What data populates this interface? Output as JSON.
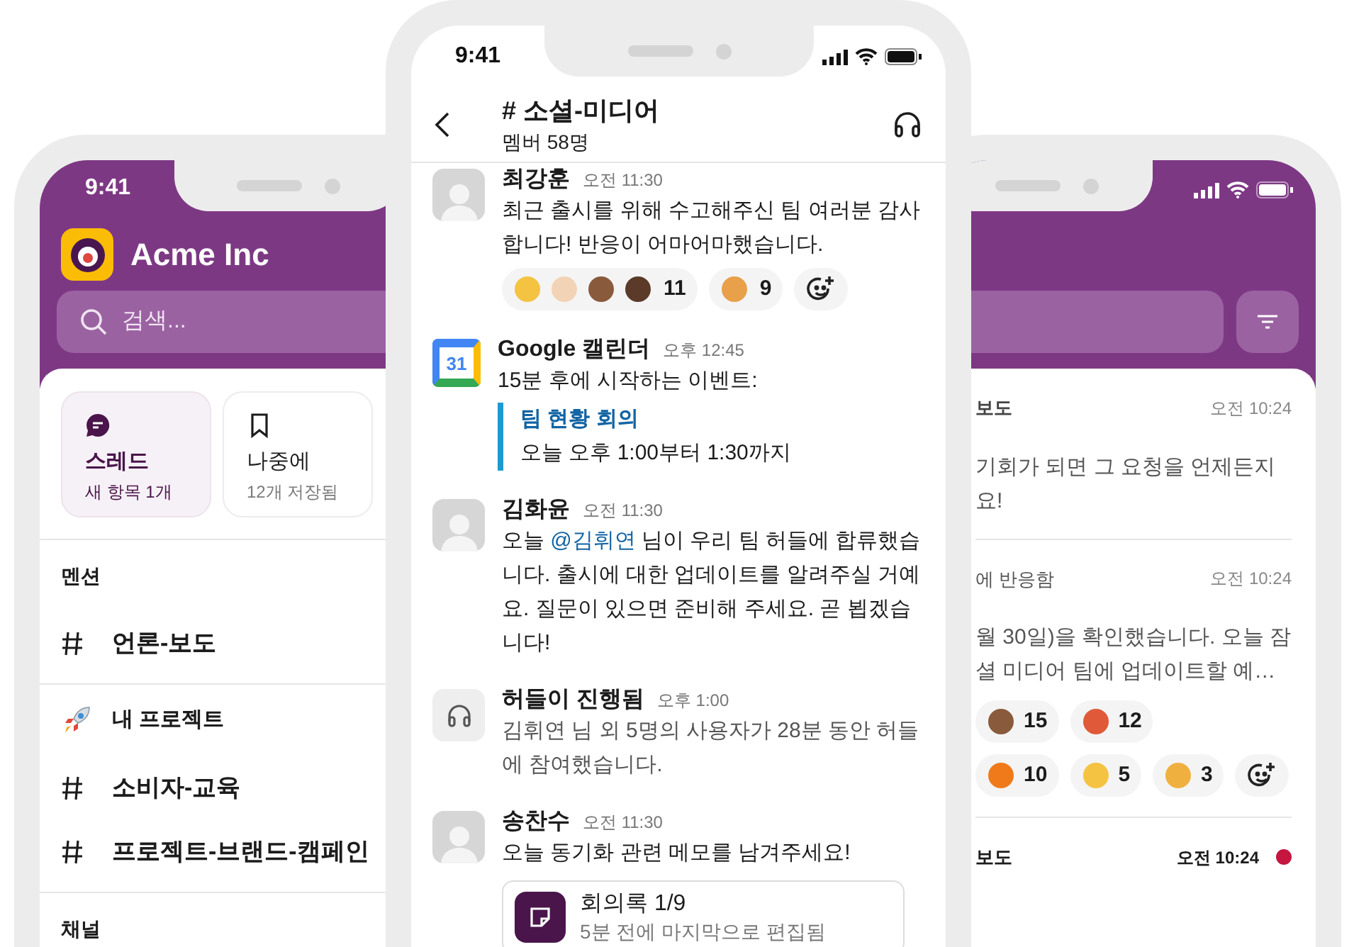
{
  "left_phone": {
    "status_time": "9:41",
    "workspace": "Acme Inc",
    "search": {
      "placeholder": "검색..."
    },
    "shortcuts": [
      {
        "kind": "thread",
        "label": "스레드",
        "sublabel": "새 항목 1개",
        "selected": true
      },
      {
        "kind": "bookmark",
        "label": "나중에",
        "sublabel": "12개 저장됨",
        "selected": false
      }
    ],
    "sections": [
      {
        "kind": "plain",
        "title": "멘션",
        "channels": [
          "언론-보도"
        ]
      },
      {
        "kind": "rocket",
        "title": "내 프로젝트",
        "channels": [
          "소비자-교육",
          "프로젝트-브랜드-캠페인"
        ]
      },
      {
        "kind": "plain",
        "title": "채널"
      }
    ]
  },
  "center_phone": {
    "status_time": "9:41",
    "channel_title": "# 소셜-미디어",
    "member_count": "멤버 58명",
    "messages": [
      {
        "kind": "user",
        "author": "최강훈",
        "time": "오전 11:30",
        "text_parts": [
          {
            "kind": "plain",
            "text": "최근 출시를 위해 수고해주신 팀 여러분 감사합니다! 반응이 어마어마했습니다."
          }
        ],
        "reactions": [
          {
            "emojis": [
              {
                "kind": "clap_default"
              },
              {
                "kind": "clap_light"
              },
              {
                "kind": "clap_medium_dark"
              },
              {
                "kind": "clap_dark"
              }
            ],
            "count": "11"
          },
          {
            "emojis": [
              {
                "kind": "party"
              }
            ],
            "count": "9"
          }
        ]
      },
      {
        "kind": "calendar",
        "author": "Google 캘린더",
        "time": "오후 12:45",
        "calendar_day": "31",
        "text_parts": [
          {
            "kind": "plain",
            "text": "15분 후에 시작하는 이벤트:"
          }
        ],
        "event": {
          "title": "팀 현황 회의",
          "subtitle": "오늘 오후 1:00부터 1:30까지"
        }
      },
      {
        "kind": "user",
        "author": "김화윤",
        "time": "오전 11:30",
        "text_parts": [
          {
            "kind": "plain",
            "text": "오늘 "
          },
          {
            "kind": "mention",
            "text": "@김휘연"
          },
          {
            "kind": "plain",
            "text": " 님이 우리 팀 허들에 합류했습니다. 출시에 대한 업데이트를 알려주실 거예요. 질문이 있으면 준비해 주세요. 곧 뵙겠습니다!"
          }
        ]
      },
      {
        "kind": "huddle",
        "author": "허들이 진행됨",
        "time": "오후 1:00",
        "text_parts": [
          {
            "kind": "plain",
            "text": "김휘연 님 외 5명의 사용자가 28분 동안 허들에 참여했습니다."
          }
        ]
      },
      {
        "kind": "user",
        "author": "송찬수",
        "time": "오전 11:30",
        "text_parts": [
          {
            "kind": "plain",
            "text": "오늘 동기화 관련 메모를 남겨주세요!"
          }
        ],
        "attachment": {
          "title": "회의록 1/9",
          "subtitle": "5분 전에 마지막으로 편집됨"
        }
      }
    ]
  },
  "right_phone": {
    "items": [
      {
        "header": "보도",
        "time": "오전 10:24",
        "unread": false,
        "text_lines": [
          "기회가 되면 그 요청을 언제든지",
          "요!"
        ]
      },
      {
        "header": "에 반응함",
        "time": "오전 10:24",
        "unread": false,
        "text_lines": [
          "월 30일)을 확인했습니다. 오늘 잠",
          "셜 미디어 팀에 업데이트할 예…"
        ],
        "reaction_rows": [
          [
            {
              "kind": "thumbs_up",
              "count": "15"
            },
            {
              "kind": "rocket",
              "count": "12"
            }
          ],
          [
            {
              "kind": "fire",
              "count": "10"
            },
            {
              "kind": "sparkles",
              "count": "5"
            },
            {
              "kind": "handshake",
              "count": "3"
            }
          ]
        ]
      },
      {
        "header": "보도",
        "time": "오전 10:24",
        "unread": true
      }
    ]
  }
}
